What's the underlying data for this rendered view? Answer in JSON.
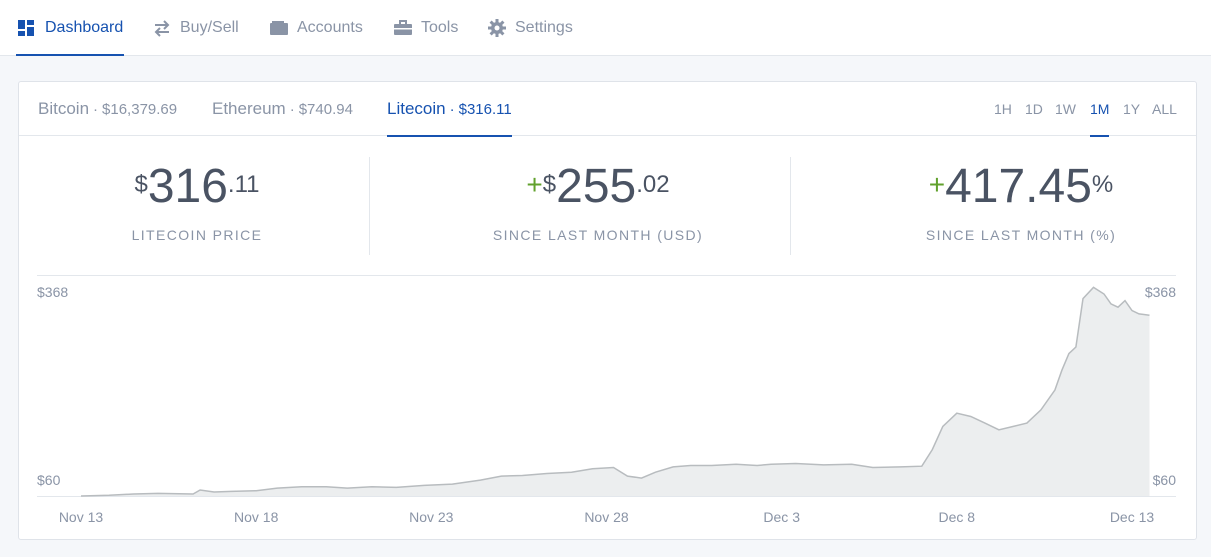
{
  "nav": {
    "items": [
      {
        "label": "Dashboard",
        "icon": "dashboard-icon",
        "active": true
      },
      {
        "label": "Buy/Sell",
        "icon": "swap-arrows-icon"
      },
      {
        "label": "Accounts",
        "icon": "wallet-icon"
      },
      {
        "label": "Tools",
        "icon": "briefcase-icon"
      },
      {
        "label": "Settings",
        "icon": "gear-icon"
      }
    ]
  },
  "coins": [
    {
      "name": "Bitcoin",
      "sep": "·",
      "price": "$16,379.69"
    },
    {
      "name": "Ethereum",
      "sep": "·",
      "price": "$740.94"
    },
    {
      "name": "Litecoin",
      "sep": "·",
      "price": "$316.11",
      "active": true
    }
  ],
  "ranges": [
    "1H",
    "1D",
    "1W",
    "1M",
    "1Y",
    "ALL"
  ],
  "active_range": "1M",
  "stats": {
    "price": {
      "currency": "$",
      "whole": "316",
      "cents": ".11",
      "label": "LITECOIN PRICE"
    },
    "change_usd": {
      "sign": "+",
      "currency": "$",
      "whole": "255",
      "cents": ".02",
      "label": "SINCE LAST MONTH (USD)"
    },
    "change_pct": {
      "sign": "+",
      "whole": "417.45",
      "suffix": "%",
      "label": "SINCE LAST MONTH (%)"
    }
  },
  "colors": {
    "accent": "#1652b0",
    "positive": "#61a12d",
    "text": "#4a5363",
    "muted": "#8a94a6",
    "area_fill": "#eceeef",
    "line": "#b8bcbf"
  },
  "chart_data": {
    "type": "area",
    "y_left_labels": [
      "$368",
      "$60"
    ],
    "y_right_labels": [
      "$368",
      "$60"
    ],
    "x_labels": [
      "Nov 13",
      "Nov 18",
      "Nov 23",
      "Nov 28",
      "Dec 3",
      "Dec 8",
      "Dec 13"
    ],
    "series": [
      {
        "values": [
          [
            13.0,
            60
          ],
          [
            13.8,
            61
          ],
          [
            14.5,
            63
          ],
          [
            15.2,
            64
          ],
          [
            16.2,
            63
          ],
          [
            16.4,
            69
          ],
          [
            16.8,
            66
          ],
          [
            17.3,
            67
          ],
          [
            18.0,
            68
          ],
          [
            18.6,
            72
          ],
          [
            19.3,
            74
          ],
          [
            20.0,
            74
          ],
          [
            20.6,
            72
          ],
          [
            21.3,
            74
          ],
          [
            22.0,
            73
          ],
          [
            22.8,
            76
          ],
          [
            23.6,
            78
          ],
          [
            24.4,
            84
          ],
          [
            25.0,
            90
          ],
          [
            25.6,
            91
          ],
          [
            26.3,
            94
          ],
          [
            27.0,
            96
          ],
          [
            27.6,
            101
          ],
          [
            28.2,
            103
          ],
          [
            28.6,
            90
          ],
          [
            29.0,
            87
          ],
          [
            29.4,
            96
          ],
          [
            29.9,
            104
          ],
          [
            30.4,
            106
          ],
          [
            31.0,
            106
          ],
          [
            31.7,
            108
          ],
          [
            32.3,
            106
          ],
          [
            32.7,
            108
          ],
          [
            33.4,
            109
          ],
          [
            34.2,
            107
          ],
          [
            35.0,
            108
          ],
          [
            35.6,
            103
          ],
          [
            36.4,
            104
          ],
          [
            37.0,
            105
          ],
          [
            37.3,
            130
          ],
          [
            37.6,
            165
          ],
          [
            38.0,
            185
          ],
          [
            38.4,
            180
          ],
          [
            38.8,
            170
          ],
          [
            39.2,
            160
          ],
          [
            39.6,
            165
          ],
          [
            40.0,
            170
          ],
          [
            40.4,
            190
          ],
          [
            40.8,
            220
          ],
          [
            41.0,
            250
          ],
          [
            41.2,
            275
          ],
          [
            41.4,
            285
          ],
          [
            41.6,
            358
          ],
          [
            41.9,
            375
          ],
          [
            42.2,
            365
          ],
          [
            42.4,
            350
          ],
          [
            42.6,
            345
          ],
          [
            42.8,
            355
          ],
          [
            43.0,
            340
          ],
          [
            43.2,
            335
          ],
          [
            43.5,
            333
          ]
        ]
      }
    ]
  }
}
